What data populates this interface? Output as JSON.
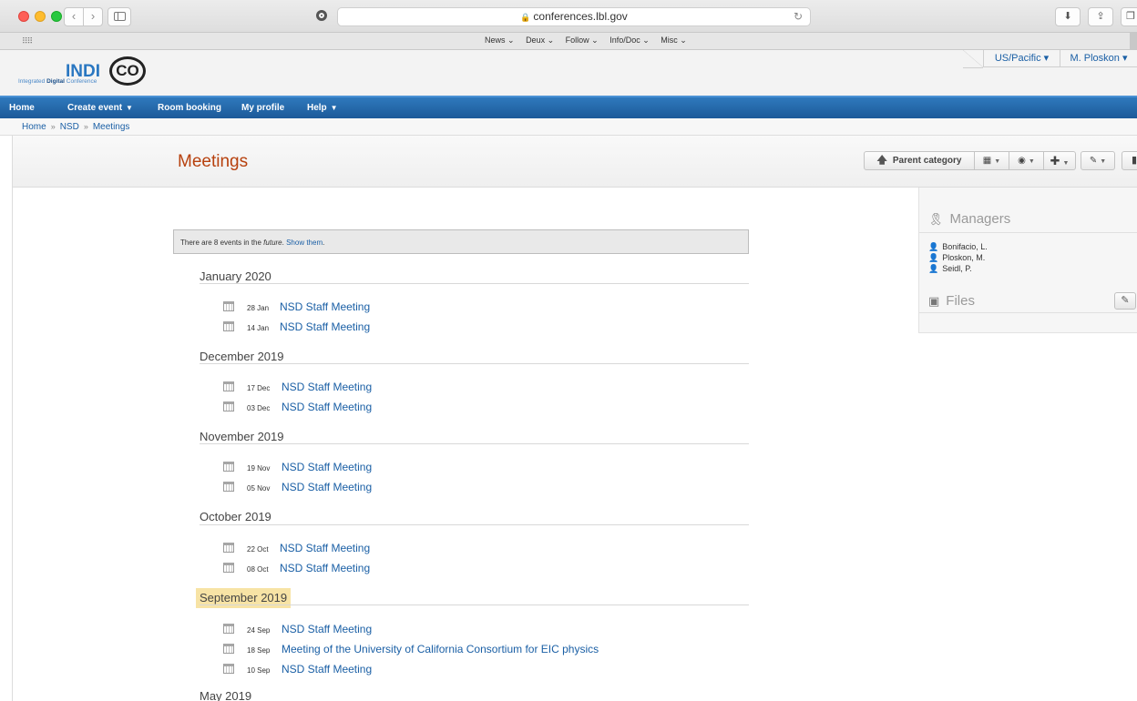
{
  "browser": {
    "url": "conferences.lbl.gov",
    "bookmarks": [
      "News ⌄",
      "Deux ⌄",
      "Follow ⌄",
      "Info/Doc ⌄",
      "Misc ⌄"
    ]
  },
  "header": {
    "logo_main": "INDI",
    "logo_co": "CO",
    "logo_tagline_prefix": "Integrated ",
    "logo_tagline_bold": "Digital",
    "logo_tagline_suffix": " Conference",
    "timezone": "US/Pacific ▾",
    "user": "M. Ploskon ▾"
  },
  "nav": {
    "home": "Home",
    "create_event": "Create event",
    "room_booking": "Room booking",
    "my_profile": "My profile",
    "help": "Help"
  },
  "breadcrumb": {
    "items": [
      "Home",
      "NSD",
      "Meetings"
    ],
    "sep": "»"
  },
  "page": {
    "title": "Meetings",
    "parent_category": "Parent category"
  },
  "notice": {
    "prefix": "There are 8 events in the ",
    "emph": "future",
    "middle": ". ",
    "link": "Show them",
    "suffix": "."
  },
  "months": [
    {
      "label": "January 2020",
      "events": [
        {
          "date": "28 Jan",
          "title": "NSD Staff Meeting"
        },
        {
          "date": "14 Jan",
          "title": "NSD Staff Meeting"
        }
      ]
    },
    {
      "label": "December 2019",
      "events": [
        {
          "date": "17 Dec",
          "title": "NSD Staff Meeting"
        },
        {
          "date": "03 Dec",
          "title": "NSD Staff Meeting"
        }
      ]
    },
    {
      "label": "November 2019",
      "events": [
        {
          "date": "19 Nov",
          "title": "NSD Staff Meeting"
        },
        {
          "date": "05 Nov",
          "title": "NSD Staff Meeting"
        }
      ]
    },
    {
      "label": "October 2019",
      "events": [
        {
          "date": "22 Oct",
          "title": "NSD Staff Meeting"
        },
        {
          "date": "08 Oct",
          "title": "NSD Staff Meeting"
        }
      ]
    },
    {
      "label": "September 2019",
      "events": [
        {
          "date": "24 Sep",
          "title": "NSD Staff Meeting"
        },
        {
          "date": "18 Sep",
          "title": "Meeting of the University of California Consortium for EIC physics"
        },
        {
          "date": "10 Sep",
          "title": "NSD Staff Meeting"
        }
      ]
    },
    {
      "label": "May 2019",
      "events": []
    }
  ],
  "sidebar": {
    "managers_title": "Managers",
    "managers": [
      "Bonifacio, L.",
      "Ploskon, M.",
      "Seidl, P."
    ],
    "files_title": "Files"
  },
  "colors": {
    "accent_blue": "#1a5fa5",
    "title_orange": "#b7410e",
    "nav_blue": "#2f79bd",
    "highlight": "#f7e3a5"
  }
}
